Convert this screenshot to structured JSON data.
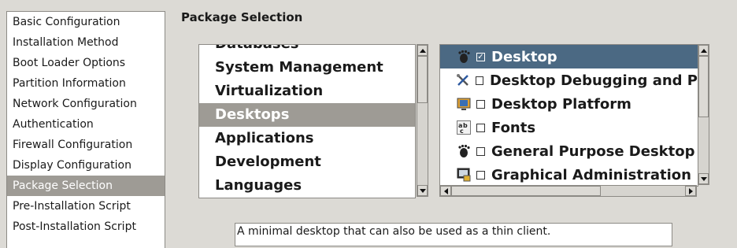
{
  "sidebar": {
    "items": [
      {
        "label": "Basic Configuration",
        "active": false
      },
      {
        "label": "Installation Method",
        "active": false
      },
      {
        "label": "Boot Loader Options",
        "active": false
      },
      {
        "label": "Partition Information",
        "active": false
      },
      {
        "label": "Network Configuration",
        "active": false
      },
      {
        "label": "Authentication",
        "active": false
      },
      {
        "label": "Firewall Configuration",
        "active": false
      },
      {
        "label": "Display Configuration",
        "active": false
      },
      {
        "label": "Package Selection",
        "active": true
      },
      {
        "label": "Pre-Installation Script",
        "active": false
      },
      {
        "label": "Post-Installation Script",
        "active": false
      }
    ]
  },
  "main": {
    "title": "Package Selection",
    "groups": [
      {
        "label": "Databases",
        "partial": true
      },
      {
        "label": "System Management"
      },
      {
        "label": "Virtualization"
      },
      {
        "label": "Desktops",
        "active": true
      },
      {
        "label": "Applications"
      },
      {
        "label": "Development"
      },
      {
        "label": "Languages"
      }
    ],
    "packages": [
      {
        "label": "Desktop",
        "checked": true,
        "active": true,
        "icon": "gnome-foot-icon"
      },
      {
        "label": "Desktop Debugging and P",
        "checked": false,
        "icon": "tools-icon"
      },
      {
        "label": "Desktop Platform",
        "checked": false,
        "icon": "desktop-platform-icon"
      },
      {
        "label": "Fonts",
        "checked": false,
        "icon": "fonts-icon"
      },
      {
        "label": "General Purpose Desktop",
        "checked": false,
        "icon": "gnome-foot-icon"
      },
      {
        "label": "Graphical Administration",
        "checked": false,
        "icon": "monitor-lock-icon"
      }
    ],
    "description": "A minimal desktop that can also be used as a thin client."
  },
  "colors": {
    "background": "#dcdad5",
    "selection_gray": "#9e9b95",
    "selection_blue": "#4b6983"
  }
}
